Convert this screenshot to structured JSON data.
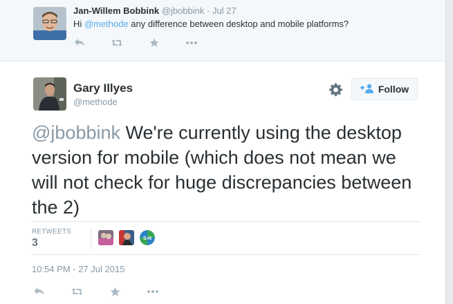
{
  "reply": {
    "name": "Jan-Willem Bobbink",
    "handle": "@jbobbink",
    "time": "· Jul 27",
    "text_prefix": "Hi ",
    "mention": "@methode",
    "text_suffix": " any difference between desktop and mobile platforms?"
  },
  "tweet": {
    "name": "Gary Illyes",
    "handle": "@methode",
    "follow_label": "Follow",
    "mention": "@jbobbink",
    "text": " We're currently using the desktop version for mobile (which does not mean we will not check for huge discrepancies between the 2)",
    "retweets_label": "RETWEETS",
    "retweets_count": "3",
    "timestamp": "10:54 PM - 27 Jul 2015",
    "retweeter_badge": "S-N"
  },
  "icons": [
    "reply-icon",
    "retweet-icon",
    "favorite-icon",
    "more-icon",
    "gear-icon",
    "follow-icon"
  ],
  "colors": {
    "accent": "#55acee",
    "muted": "#8899a6",
    "text": "#292f33",
    "bg_reply": "#f5f8fa"
  }
}
